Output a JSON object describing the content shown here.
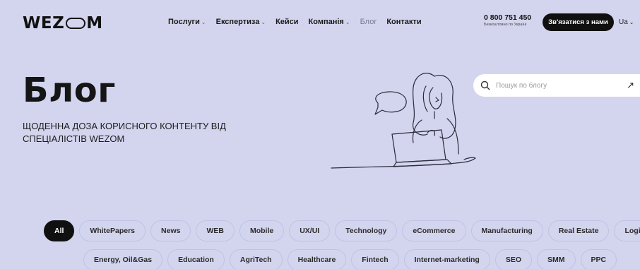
{
  "header": {
    "logo_left": "WEZ",
    "logo_right": "M",
    "nav": [
      {
        "label": "Послуги",
        "dropdown": true
      },
      {
        "label": "Експертиза",
        "dropdown": true
      },
      {
        "label": "Кейси",
        "dropdown": false
      },
      {
        "label": "Компанія",
        "dropdown": true
      },
      {
        "label": "Блог",
        "dropdown": false,
        "active": true
      },
      {
        "label": "Контакти",
        "dropdown": false
      }
    ],
    "phone": "0 800 751 450",
    "phone_note": "Безкоштовно по Україні",
    "cta_label": "Зв'язатися з нами",
    "language": "Ua"
  },
  "hero": {
    "title": "Блог",
    "subtitle": "ЩОДЕННА ДОЗА КОРИСНОГО КОНТЕНТУ ВІД СПЕЦІАЛІСТІВ WEZOM"
  },
  "search": {
    "placeholder": "Пошук по блогу",
    "arrow_icon": "↗"
  },
  "tags": {
    "row1": [
      "All",
      "WhitePapers",
      "News",
      "WEB",
      "Mobile",
      "UX/UI",
      "Technology",
      "eCommerce",
      "Manufacturing",
      "Real Estate",
      "Logistics"
    ],
    "row2": [
      "Energy, Oil&Gas",
      "Education",
      "AgriTech",
      "Healthcare",
      "Fintech",
      "Internet-marketing",
      "SEO",
      "SMM",
      "PPC"
    ],
    "active": "All"
  },
  "colors": {
    "background": "#d3d5ee",
    "accent": "#101010"
  }
}
